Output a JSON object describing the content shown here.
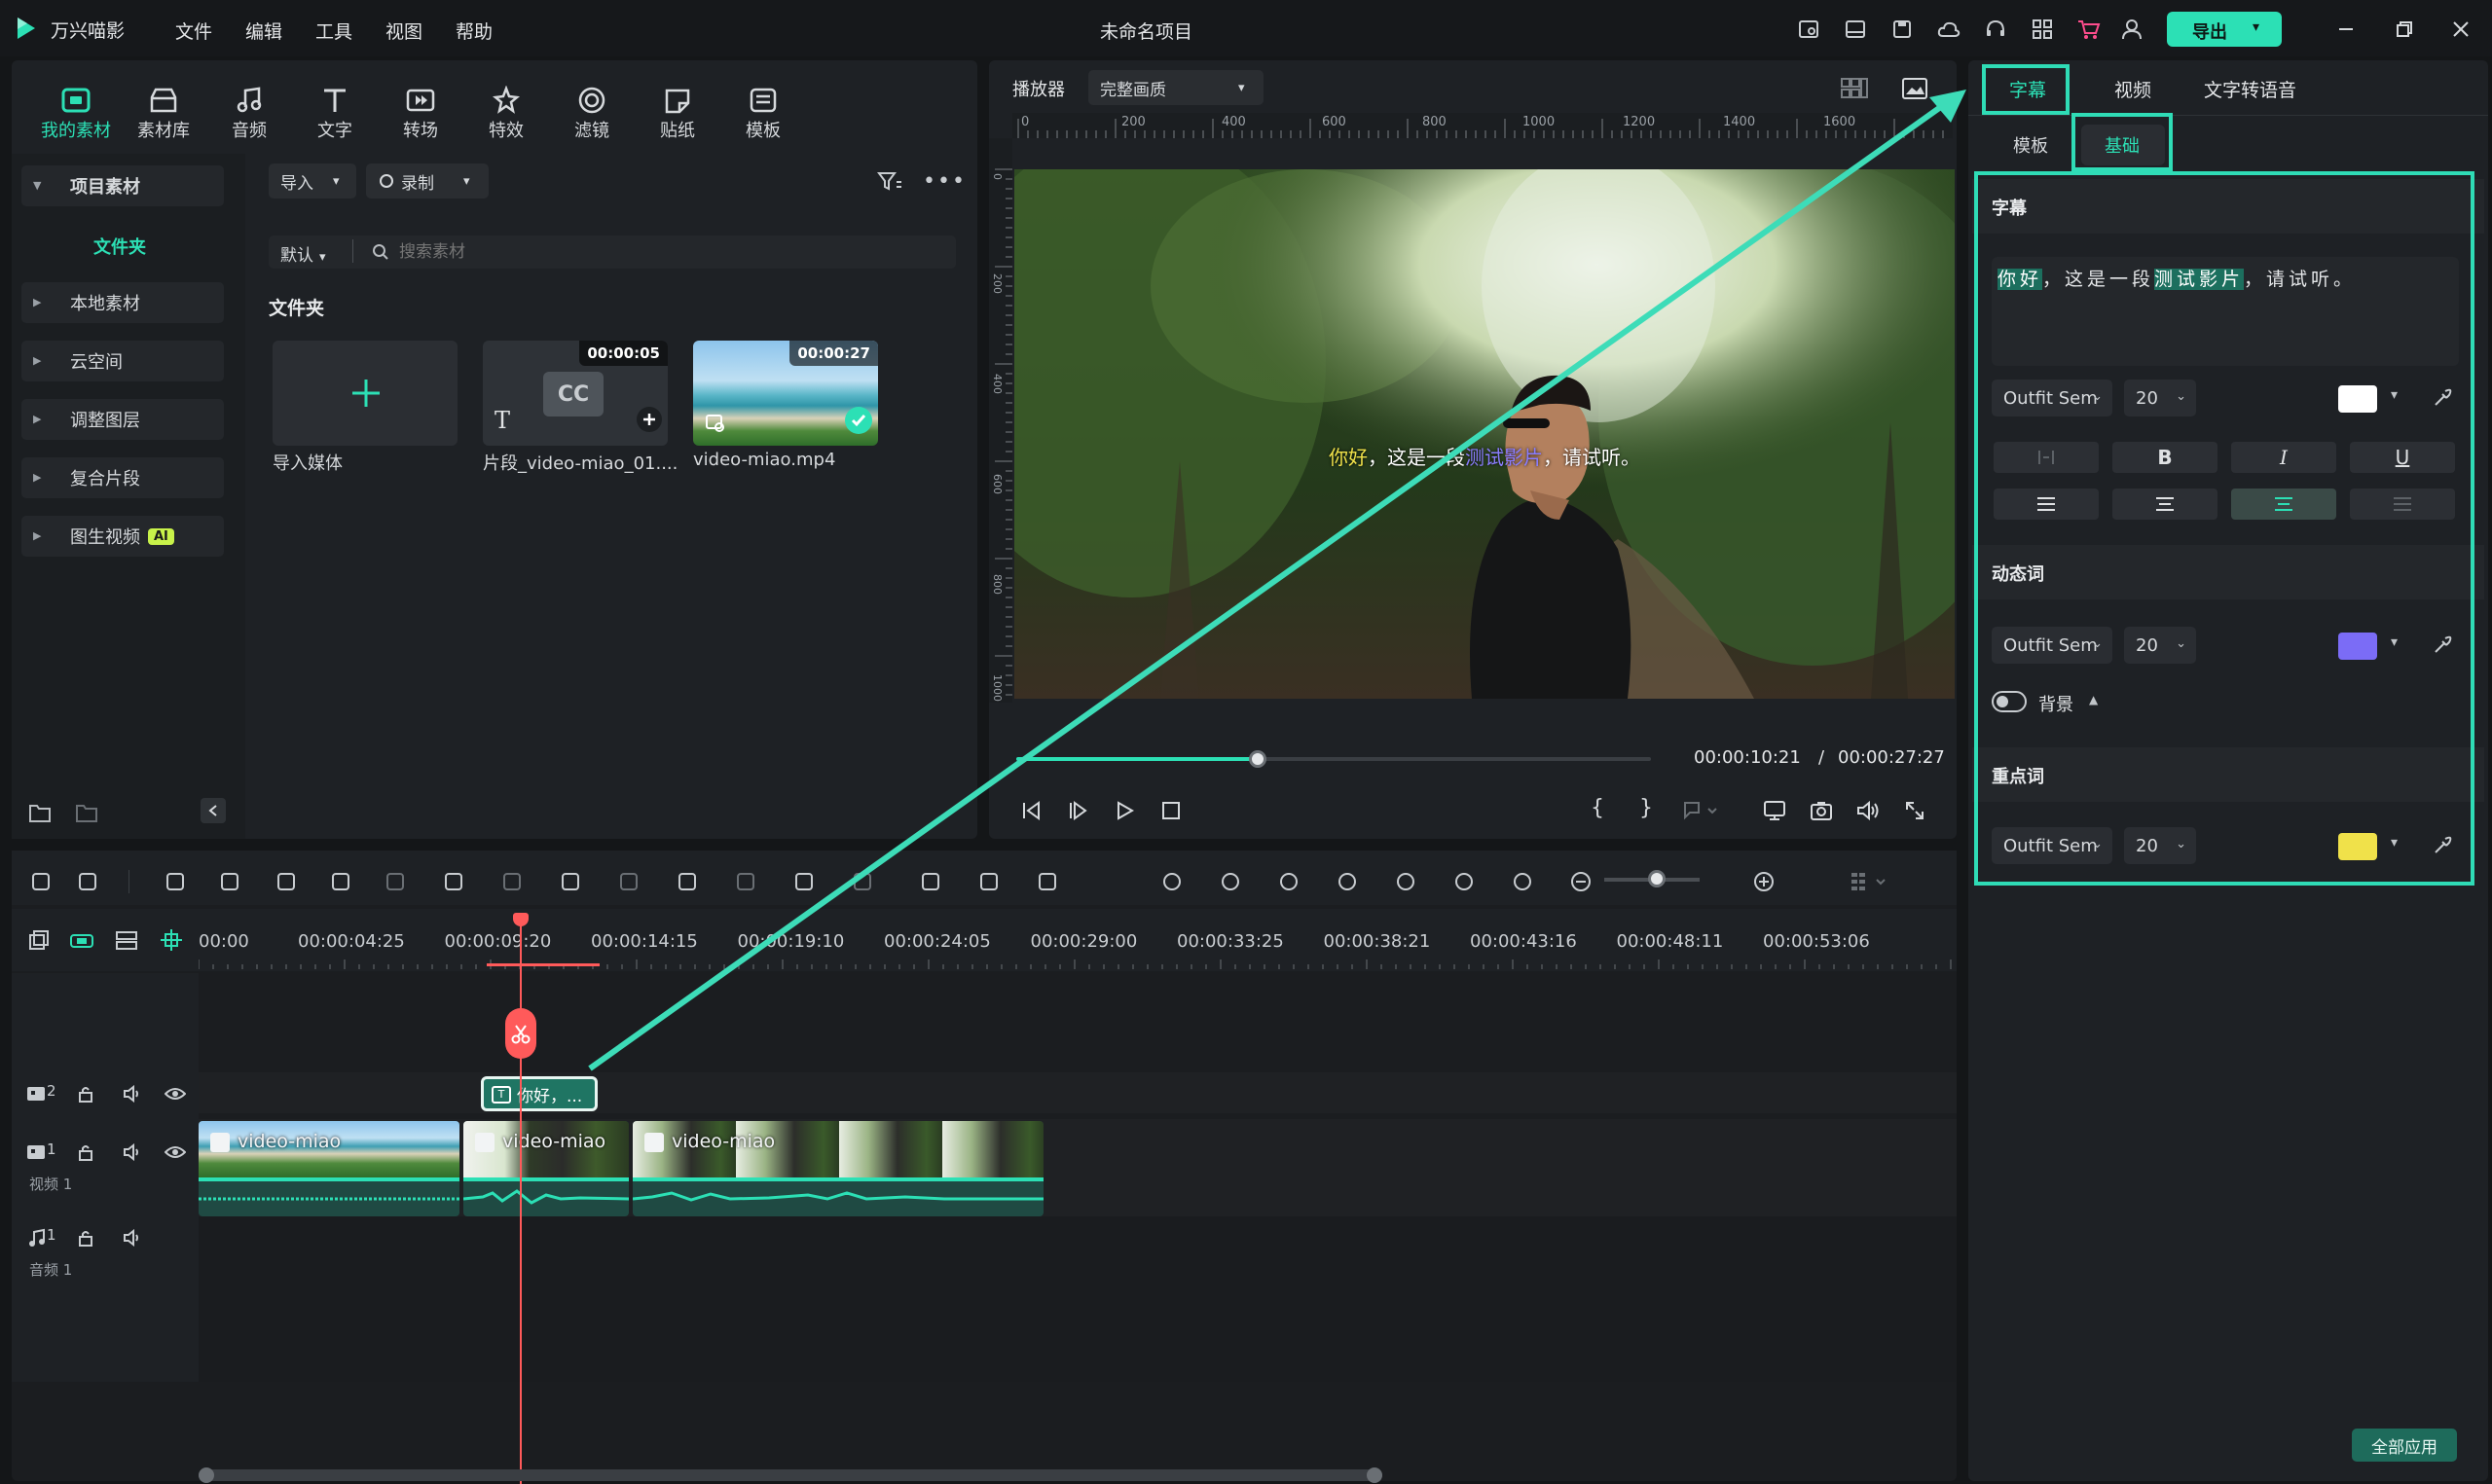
{
  "app": {
    "name": "万兴喵影",
    "project_title": "未命名项目"
  },
  "menu": [
    "文件",
    "编辑",
    "工具",
    "视图",
    "帮助"
  ],
  "export_label": "导出",
  "colors": {
    "accent": "#2ce0b5",
    "playhead": "#ff5a5a",
    "highlight_yellow": "#f0e14a",
    "highlight_purple": "#7b6cf6",
    "white": "#ffffff"
  },
  "tool_tabs": [
    {
      "label": "我的素材",
      "icon": "my-media-icon",
      "active": true
    },
    {
      "label": "素材库",
      "icon": "stock-media-icon"
    },
    {
      "label": "音频",
      "icon": "music-note-icon"
    },
    {
      "label": "文字",
      "icon": "text-t-icon"
    },
    {
      "label": "转场",
      "icon": "transition-icon"
    },
    {
      "label": "特效",
      "icon": "effects-star-icon"
    },
    {
      "label": "滤镜",
      "icon": "filter-icon"
    },
    {
      "label": "贴纸",
      "icon": "sticker-icon"
    },
    {
      "label": "模板",
      "icon": "template-icon"
    }
  ],
  "sidebar": {
    "items": [
      {
        "label": "项目素材"
      },
      {
        "label": "文件夹"
      },
      {
        "label": "本地素材"
      },
      {
        "label": "云空间"
      },
      {
        "label": "调整图层"
      },
      {
        "label": "复合片段"
      },
      {
        "label": "图生视频",
        "badge": "AI"
      }
    ]
  },
  "media": {
    "import_label": "导入",
    "record_label": "录制",
    "sort_label": "默认",
    "search_placeholder": "搜索素材",
    "folder_heading": "文件夹",
    "items": [
      {
        "name": "导入媒体"
      },
      {
        "name": "片段_video-miao_01....",
        "duration": "00:00:05",
        "badge": "CC"
      },
      {
        "name": "video-miao.mp4",
        "duration": "00:00:27"
      }
    ]
  },
  "player": {
    "label": "播放器",
    "quality": "完整画质",
    "ruler_h": [
      "0",
      "200",
      "400",
      "600",
      "800",
      "1000",
      "1200",
      "1400",
      "1600"
    ],
    "ruler_v": [
      "0",
      "200",
      "400",
      "600",
      "800",
      "1000"
    ],
    "subtitle": {
      "part1": "你好",
      "part2": "，这是一段",
      "part3": "测试影片",
      "part4": "，请试听。"
    },
    "current_time": "00:00:10:21",
    "separator": "/",
    "total_time": "00:00:27:27",
    "progress": 0.38
  },
  "right_panel": {
    "tabs": [
      "字幕",
      "视频",
      "文字转语音"
    ],
    "sub_tabs": [
      "模板",
      "基础"
    ],
    "subtitle_section": "字幕",
    "subtitle_text": {
      "w1": "你好",
      "w2": "，这是一段",
      "w3": "测试影片",
      "w4": "，请试听。"
    },
    "font": "Outfit Sem",
    "size": "20",
    "format_buttons": [
      "B",
      "I",
      "U"
    ],
    "dynamic_section": "动态词",
    "bg_label": "背景",
    "keyword_section": "重点词",
    "apply_all": "全部应用"
  },
  "timeline": {
    "ruler": [
      "00:00",
      "00:00:04:25",
      "00:00:09:20",
      "00:00:14:15",
      "00:00:19:10",
      "00:00:24:05",
      "00:00:29:00",
      "00:00:33:25",
      "00:00:38:21",
      "00:00:43:16",
      "00:00:48:11",
      "00:00:53:06"
    ],
    "tracks": [
      {
        "num": "2"
      },
      {
        "num": "1",
        "name": "视频 1"
      },
      {
        "num": "1",
        "name": "音频 1"
      }
    ],
    "subtitle_clip": "你好，...",
    "video_clips": [
      "video-miao",
      "video-miao",
      "video-miao"
    ],
    "zoom_level": 0.55
  }
}
